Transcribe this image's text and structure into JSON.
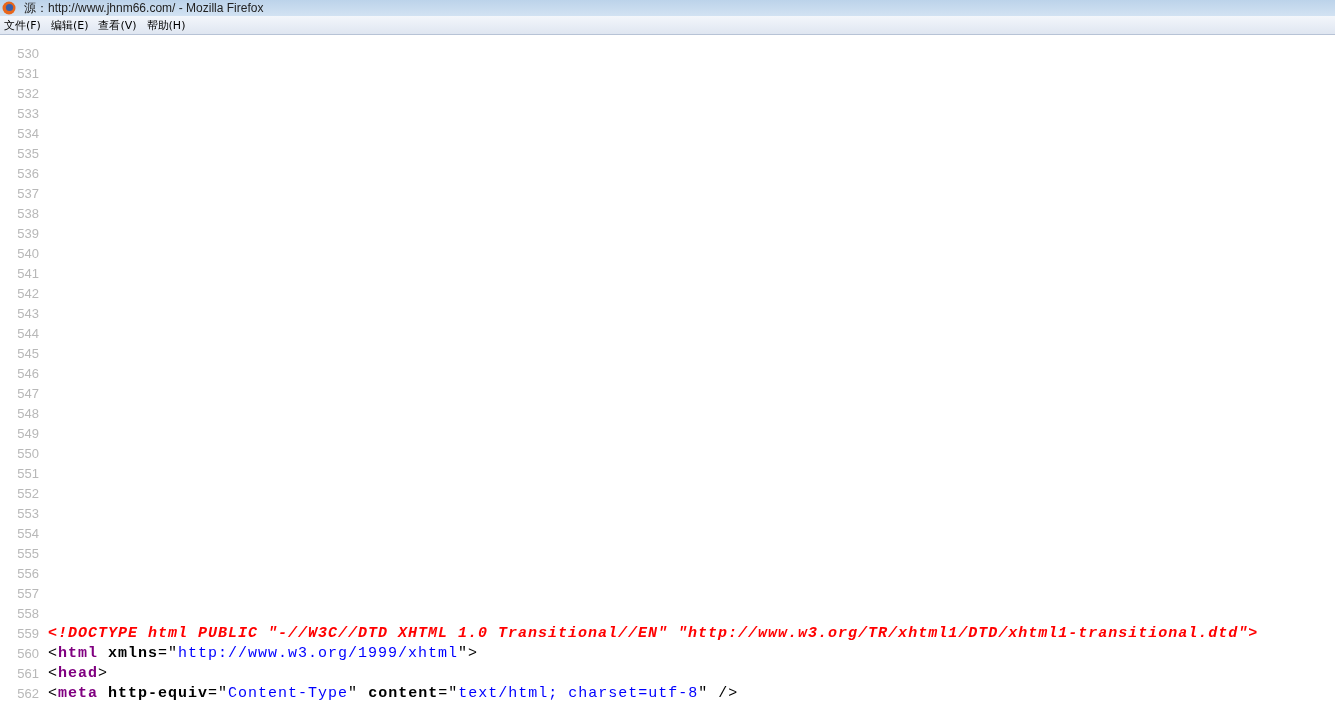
{
  "window": {
    "title": "源：http://www.jhnm66.com/ - Mozilla Firefox"
  },
  "menu": [
    {
      "label": "文件(F)"
    },
    {
      "label": "编辑(E)"
    },
    {
      "label": "查看(V)"
    },
    {
      "label": "帮助(H)"
    }
  ],
  "lines": [
    {
      "number": "530"
    },
    {
      "number": "531"
    },
    {
      "number": "532"
    },
    {
      "number": "533"
    },
    {
      "number": "534"
    },
    {
      "number": "535"
    },
    {
      "number": "536"
    },
    {
      "number": "537"
    },
    {
      "number": "538"
    },
    {
      "number": "539"
    },
    {
      "number": "540"
    },
    {
      "number": "541"
    },
    {
      "number": "542"
    },
    {
      "number": "543"
    },
    {
      "number": "544"
    },
    {
      "number": "545"
    },
    {
      "number": "546"
    },
    {
      "number": "547"
    },
    {
      "number": "548"
    },
    {
      "number": "549"
    },
    {
      "number": "550"
    },
    {
      "number": "551"
    },
    {
      "number": "552"
    },
    {
      "number": "553"
    },
    {
      "number": "554"
    },
    {
      "number": "555"
    },
    {
      "number": "556"
    },
    {
      "number": "557"
    },
    {
      "number": "558"
    },
    {
      "number": "559",
      "tokens": [
        {
          "kind": "doctype",
          "text": "<!DOCTYPE html PUBLIC \"-//W3C//DTD XHTML 1.0 Transitional//EN\" \"http://www.w3.org/TR/xhtml1/DTD/xhtml1-transitional.dtd\">"
        }
      ]
    },
    {
      "number": "560",
      "tokens": [
        {
          "kind": "punct",
          "text": "<"
        },
        {
          "kind": "tag",
          "text": "html"
        },
        {
          "kind": "attr",
          "text": " xmlns"
        },
        {
          "kind": "punct",
          "text": "=\""
        },
        {
          "kind": "value",
          "text": "http://www.w3.org/1999/xhtml"
        },
        {
          "kind": "punct",
          "text": "\">"
        }
      ]
    },
    {
      "number": "561",
      "tokens": [
        {
          "kind": "punct",
          "text": "<"
        },
        {
          "kind": "tag",
          "text": "head"
        },
        {
          "kind": "punct",
          "text": ">"
        }
      ]
    },
    {
      "number": "562",
      "tokens": [
        {
          "kind": "punct",
          "text": "<"
        },
        {
          "kind": "tag",
          "text": "meta"
        },
        {
          "kind": "attr",
          "text": " http-equiv"
        },
        {
          "kind": "punct",
          "text": "=\""
        },
        {
          "kind": "value",
          "text": "Content-Type"
        },
        {
          "kind": "punct",
          "text": "\""
        },
        {
          "kind": "attr",
          "text": " content"
        },
        {
          "kind": "punct",
          "text": "=\""
        },
        {
          "kind": "value",
          "text": "text/html; charset=utf-8"
        },
        {
          "kind": "punct",
          "text": "\" />"
        }
      ]
    }
  ]
}
